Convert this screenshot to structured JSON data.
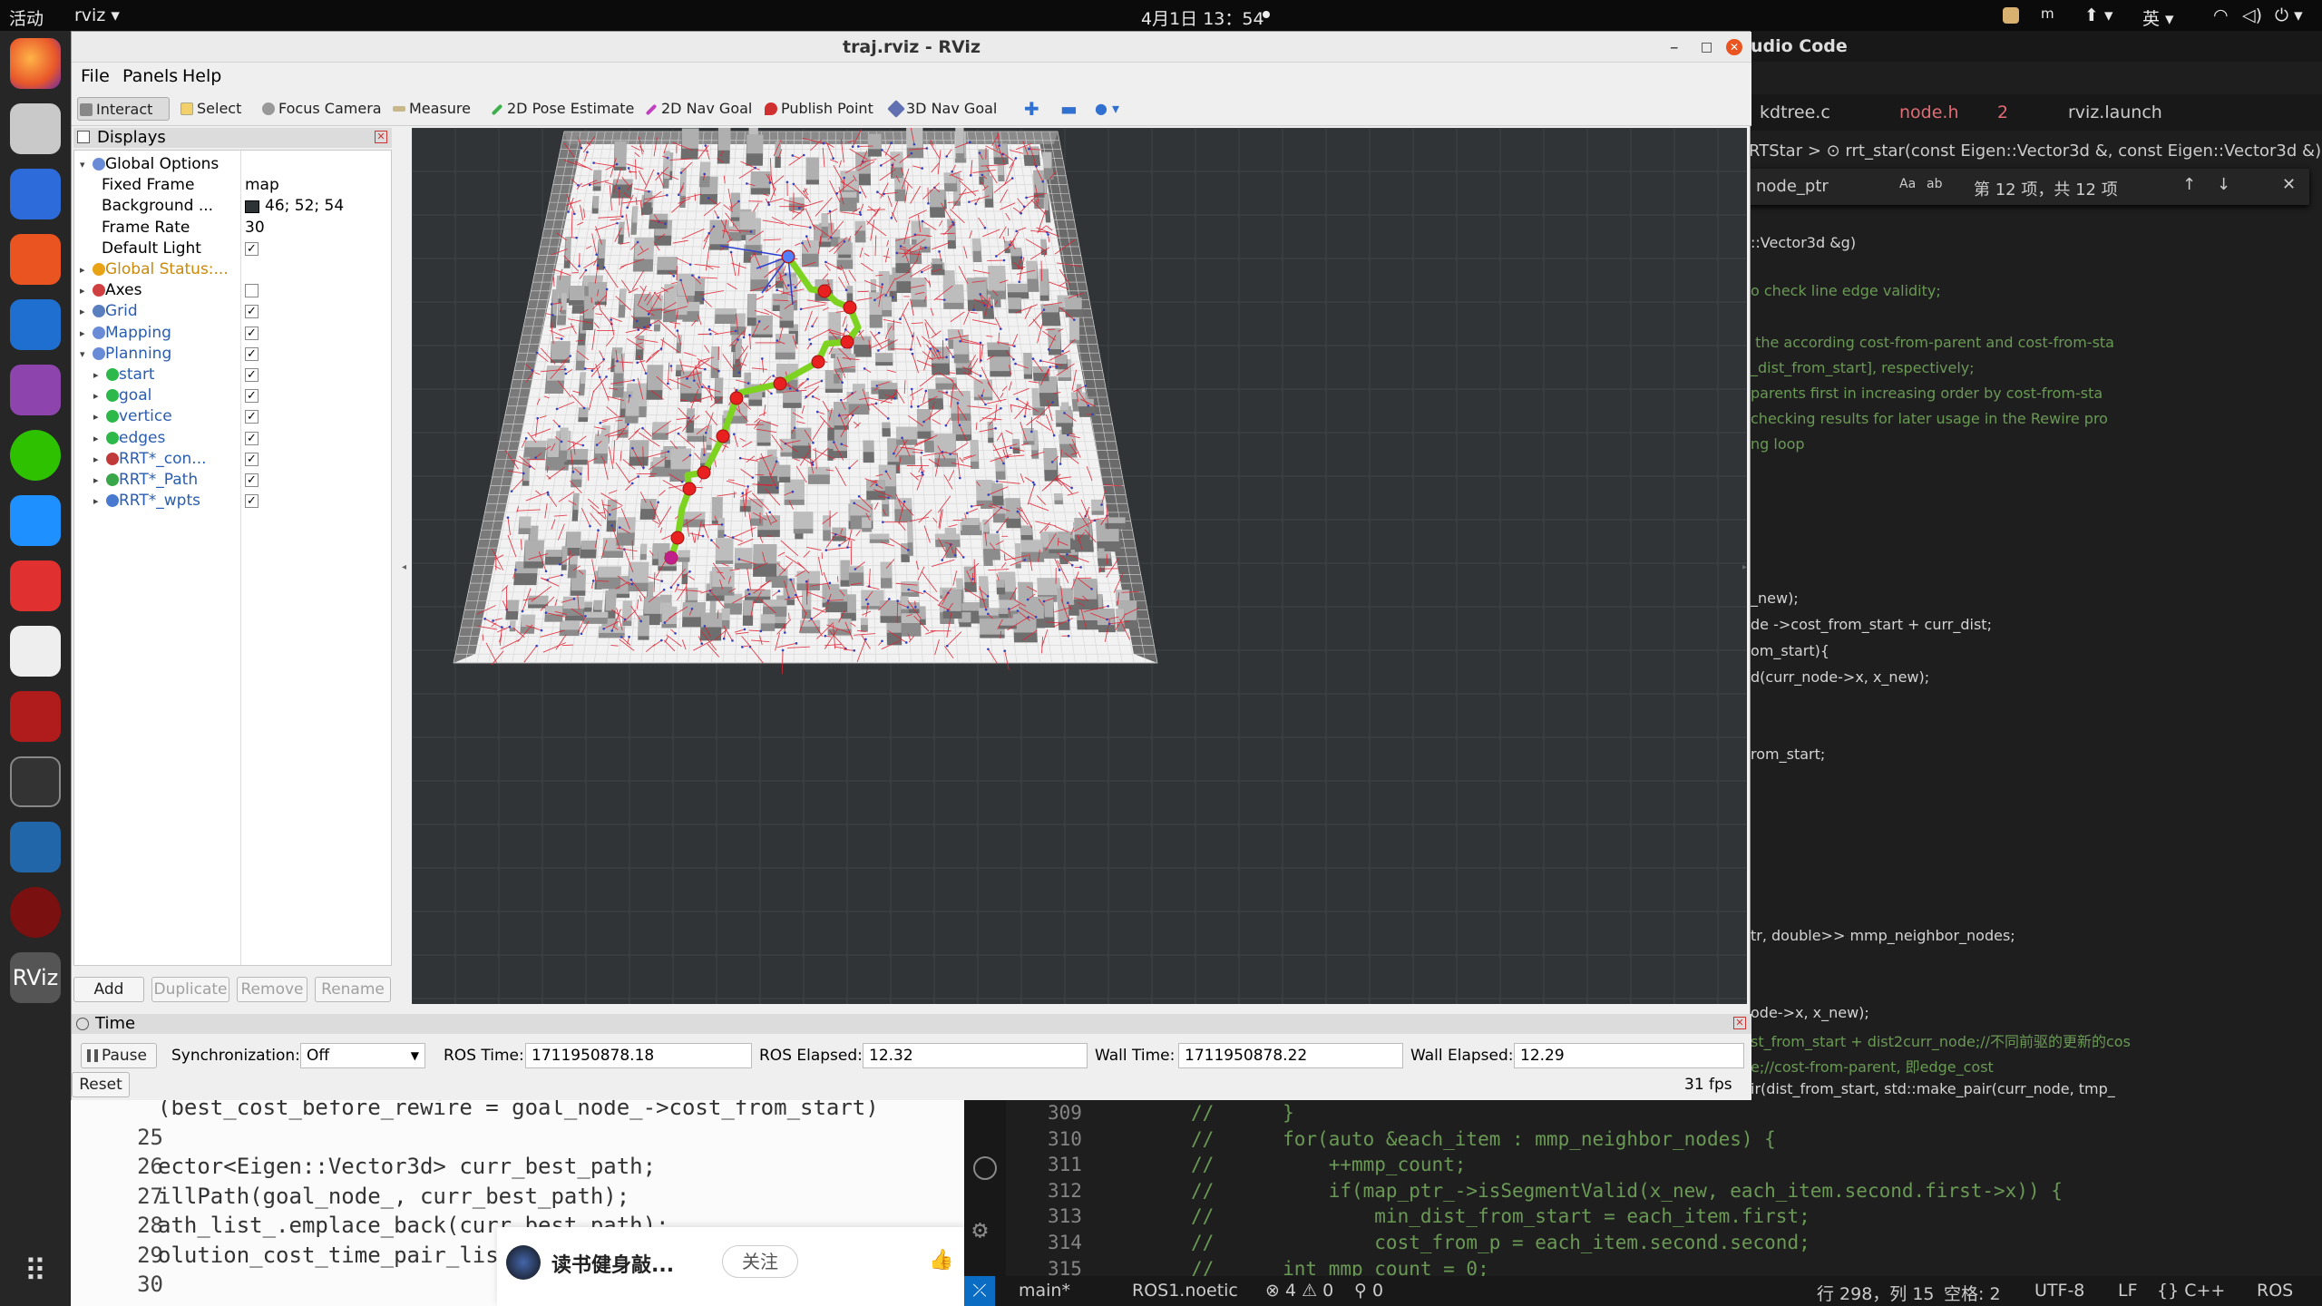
{
  "topbar": {
    "activities": "活动",
    "app": "rviz ▾",
    "clock": "4月1日 13：54",
    "right_items": [
      "英 ▾"
    ]
  },
  "vscode": {
    "window_title": "udio Code",
    "tabs": [
      "kdtree.c",
      "node.h",
      "rviz.launch"
    ],
    "tab_badge": "2",
    "breadcrumb": "RTStar > ⊙ rrt_star(const Eigen::Vector3d &, const Eigen::Vector3d &)",
    "find_value": "node_ptr",
    "find_result": "第 12 项，共 12 项",
    "lines": [
      "::Vector3d &g)",
      "o check line edge validity;",
      " the according cost-from-parent and cost-from-sta",
      "_dist_from_start], respectively;",
      "parents first in increasing order by cost-from-sta",
      "checking results for later usage in the Rewire pro",
      "ng loop",
      "_new);",
      "de ->cost_from_start + curr_dist;",
      "om_start){",
      "d(curr_node->x, x_new);",
      "rom_start;",
      "tr, double>> mmp_neighbor_nodes;",
      "ode->x, x_new);",
      "st_from_start + dist2curr_node;//不同前驱的更新的cos",
      "e;//cost-from-parent, 即edge_cost",
      "ir(dist_from_start, std::make_pair(curr_node, tmp_"
    ],
    "bottom_lines": [
      {
        "n": "309",
        "t": "//      }"
      },
      {
        "n": "310",
        "t": "//      for(auto &each_item : mmp_neighbor_nodes) {"
      },
      {
        "n": "311",
        "t": "//          ++mmp_count;"
      },
      {
        "n": "312",
        "t": "//          if(map_ptr_->isSegmentValid(x_new, each_item.second.first->x)) {"
      },
      {
        "n": "313",
        "t": "//              min_dist_from_start = each_item.first;"
      },
      {
        "n": "314",
        "t": "//              cost_from_p = each_item.second.second;"
      },
      {
        "n": "315",
        "t": "//      int mmp_count = 0;"
      }
    ],
    "status": {
      "branch": "main*",
      "ros": "ROS1.noetic",
      "problems": "⊗ 4 ⚠ 0",
      "ports": "⚲ 0",
      "position": "行 298，列 15",
      "spaces": "空格: 2",
      "encoding": "UTF-8",
      "eol": "LF",
      "lang": "{} C++",
      "ext": "ROS"
    }
  },
  "webpane": {
    "lines": [
      {
        "n": "",
        "t": "(best_cost_before_rewire = goal_node_->cost_from_start)"
      },
      {
        "n": "25",
        "t": ""
      },
      {
        "n": "26",
        "t": "ector<Eigen::Vector3d> curr_best_path;"
      },
      {
        "n": "27",
        "t": "illPath(goal_node_, curr_best_path);"
      },
      {
        "n": "28",
        "t": "ath_list_.emplace_back(curr_best_path);"
      },
      {
        "n": "29",
        "t": "olution_cost_time_pair_list_.e"
      },
      {
        "n": "30",
        "t": ""
      }
    ],
    "author": "读书健身敲...",
    "follow": "关注"
  },
  "rviz": {
    "title": "traj.rviz - RViz",
    "menu": [
      "File",
      "Panels",
      "Help"
    ],
    "tools": [
      "Interact",
      "Select",
      "Focus Camera",
      "Measure",
      "2D Pose Estimate",
      "2D Nav Goal",
      "Publish Point",
      "3D Nav Goal"
    ],
    "displays_title": "Displays",
    "tree": [
      {
        "label": "Global Options",
        "indent": 0,
        "arrow": "▾",
        "icon": "#6a8bd6",
        "value": "",
        "check": null,
        "color": "#000"
      },
      {
        "label": "Fixed Frame",
        "indent": 2,
        "arrow": "",
        "icon": "",
        "value": "map",
        "check": null,
        "color": "#000"
      },
      {
        "label": "Background ...",
        "indent": 2,
        "arrow": "",
        "icon": "",
        "value": "46; 52; 54",
        "swatch": true,
        "check": null,
        "color": "#000"
      },
      {
        "label": "Frame Rate",
        "indent": 2,
        "arrow": "",
        "icon": "",
        "value": "30",
        "check": null,
        "color": "#000"
      },
      {
        "label": "Default Light",
        "indent": 2,
        "arrow": "",
        "icon": "",
        "value": "",
        "check": true,
        "color": "#000"
      },
      {
        "label": "Global Status:...",
        "indent": 0,
        "arrow": "▸",
        "icon": "#e8a317",
        "value": "",
        "check": null,
        "color": "#c9890a"
      },
      {
        "label": "Axes",
        "indent": 0,
        "arrow": "▸",
        "icon": "#d04040",
        "value": "",
        "check": false,
        "color": "#000"
      },
      {
        "label": "Grid",
        "indent": 0,
        "arrow": "▸",
        "icon": "#5a7fbf",
        "value": "",
        "check": true,
        "color": "#2a5db0"
      },
      {
        "label": "Mapping",
        "indent": 0,
        "arrow": "▸",
        "icon": "#6a8bd6",
        "value": "",
        "check": true,
        "color": "#2a5db0"
      },
      {
        "label": "Planning",
        "indent": 0,
        "arrow": "▾",
        "icon": "#6a8bd6",
        "value": "",
        "check": true,
        "color": "#2a5db0"
      },
      {
        "label": "start",
        "indent": 1,
        "arrow": "▸",
        "icon": "#2db84a",
        "value": "",
        "check": true,
        "color": "#2a5db0"
      },
      {
        "label": "goal",
        "indent": 1,
        "arrow": "▸",
        "icon": "#2db84a",
        "value": "",
        "check": true,
        "color": "#2a5db0"
      },
      {
        "label": "vertice",
        "indent": 1,
        "arrow": "▸",
        "icon": "#2db84a",
        "value": "",
        "check": true,
        "color": "#2a5db0"
      },
      {
        "label": "edges",
        "indent": 1,
        "arrow": "▸",
        "icon": "#2db84a",
        "value": "",
        "check": true,
        "color": "#2a5db0"
      },
      {
        "label": "RRT*_con...",
        "indent": 1,
        "arrow": "▸",
        "icon": "#c03a3a",
        "value": "",
        "check": true,
        "color": "#2a5db0"
      },
      {
        "label": "RRT*_Path",
        "indent": 1,
        "arrow": "▸",
        "icon": "#3aa64a",
        "value": "",
        "check": true,
        "color": "#2a5db0"
      },
      {
        "label": "RRT*_wpts",
        "indent": 1,
        "arrow": "▸",
        "icon": "#4a7ad0",
        "value": "",
        "check": true,
        "color": "#2a5db0"
      }
    ],
    "buttons": {
      "add": "Add",
      "duplicate": "Duplicate",
      "remove": "Remove",
      "rename": "Rename"
    },
    "time": {
      "title": "Time",
      "pause": "Pause",
      "sync_label": "Synchronization:",
      "sync_value": "Off",
      "ros_time_label": "ROS Time:",
      "ros_time": "1711950878.18",
      "ros_elapsed_label": "ROS Elapsed:",
      "ros_elapsed": "12.32",
      "wall_time_label": "Wall Time:",
      "wall_time": "1711950878.22",
      "wall_elapsed_label": "Wall Elapsed:",
      "wall_elapsed": "12.29",
      "reset": "Reset",
      "fps": "31 fps"
    },
    "colors": {
      "background": "#2e3436",
      "path": "#7ed321",
      "waypoint": "#e82020",
      "edges": "#e02030"
    }
  }
}
